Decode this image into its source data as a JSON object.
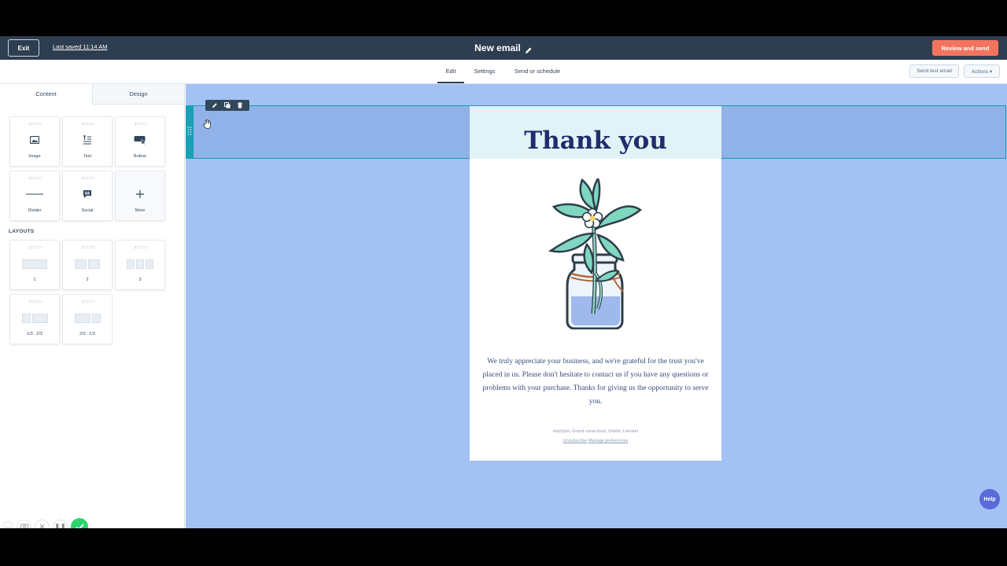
{
  "topbar": {
    "exit_label": "Exit",
    "last_saved": "Last saved 11:14 AM",
    "title": "New email",
    "review_label": "Review and send"
  },
  "subnav": {
    "tabs": [
      "Edit",
      "Settings",
      "Send or schedule"
    ],
    "active_tab": "Edit",
    "send_test_label": "Send test email",
    "actions_label": "Actions ▾"
  },
  "sidebar": {
    "tabs": [
      "Content",
      "Design"
    ],
    "active_tab": "Content",
    "content_items": [
      {
        "label": "Image",
        "icon": "image-icon"
      },
      {
        "label": "Text",
        "icon": "text-icon"
      },
      {
        "label": "Button",
        "icon": "button-icon"
      },
      {
        "label": "Divider",
        "icon": "divider-icon"
      },
      {
        "label": "Social",
        "icon": "social-hashtag-icon"
      },
      {
        "label": "More",
        "icon": "plus-icon"
      }
    ],
    "layouts_heading": "LAYOUTS",
    "layouts": [
      {
        "label": "1"
      },
      {
        "label": "2"
      },
      {
        "label": "3"
      },
      {
        "label": "1/3 : 2/3"
      },
      {
        "label": "2/3 : 1/3"
      }
    ]
  },
  "email": {
    "heading": "Thank you",
    "body": "We truly appreciate your business, and we're grateful for the trust you've placed in us. Please don't hesitate to contact us if you have any questions or problems with your purchase. Thanks for giving us the opportunity to serve you.",
    "footer_address": "HubSpot, Grand canal dock, Dublin, Leinster",
    "unsubscribe_label": "Unsubscribe",
    "manage_prefs_label": "Manage preferences"
  },
  "help_label": "Help",
  "colors": {
    "header_bg": "#2d3e50",
    "accent": "#f2745f",
    "canvas_bg": "#a4c1f4",
    "selection": "#17a2b8",
    "heading_text": "#1f2d6b"
  }
}
